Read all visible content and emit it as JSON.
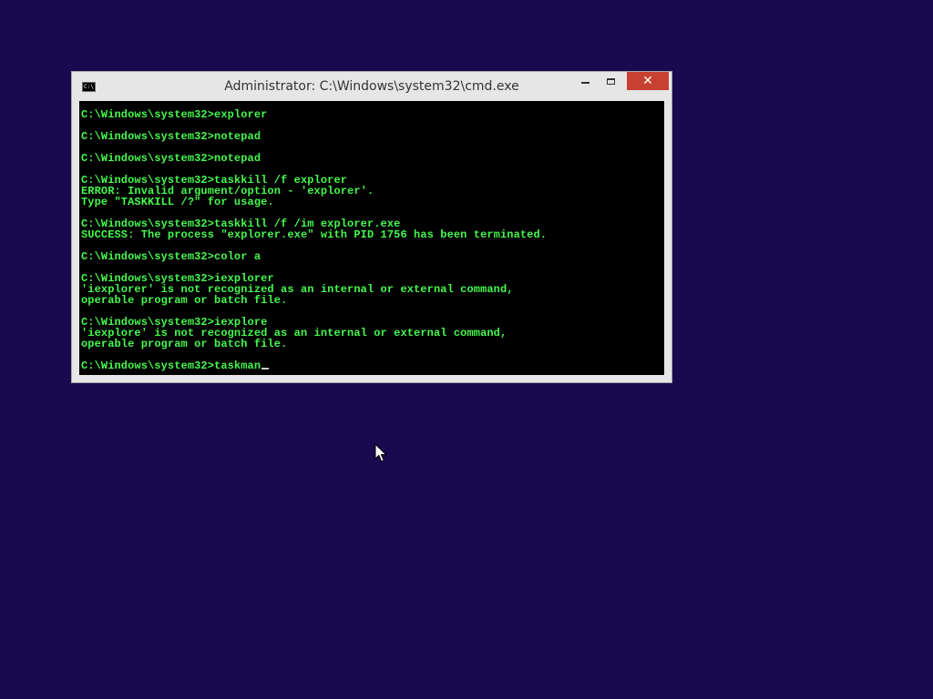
{
  "window": {
    "title": "Administrator: C:\\Windows\\system32\\cmd.exe",
    "icon_label": "C:\\",
    "buttons": {
      "minimize": "minimize",
      "maximize": "maximize",
      "close": "✕"
    }
  },
  "console": {
    "text_color": "#45f84d",
    "background_color": "#000000",
    "lines": [
      "C:\\Windows\\system32>explorer",
      "",
      "C:\\Windows\\system32>notepad",
      "",
      "C:\\Windows\\system32>notepad",
      "",
      "C:\\Windows\\system32>taskkill /f explorer",
      "ERROR: Invalid argument/option - 'explorer'.",
      "Type \"TASKKILL /?\" for usage.",
      "",
      "C:\\Windows\\system32>taskkill /f /im explorer.exe",
      "SUCCESS: The process \"explorer.exe\" with PID 1756 has been terminated.",
      "",
      "C:\\Windows\\system32>color a",
      "",
      "C:\\Windows\\system32>iexplorer",
      "'iexplorer' is not recognized as an internal or external command,",
      "operable program or batch file.",
      "",
      "C:\\Windows\\system32>iexplore",
      "'iexplore' is not recognized as an internal or external command,",
      "operable program or batch file.",
      ""
    ],
    "current_input": "C:\\Windows\\system32>taskman"
  },
  "desktop": {
    "background_color": "#19094e"
  },
  "icons": {
    "app": "cmd-icon",
    "pointer": "mouse-pointer-icon"
  }
}
